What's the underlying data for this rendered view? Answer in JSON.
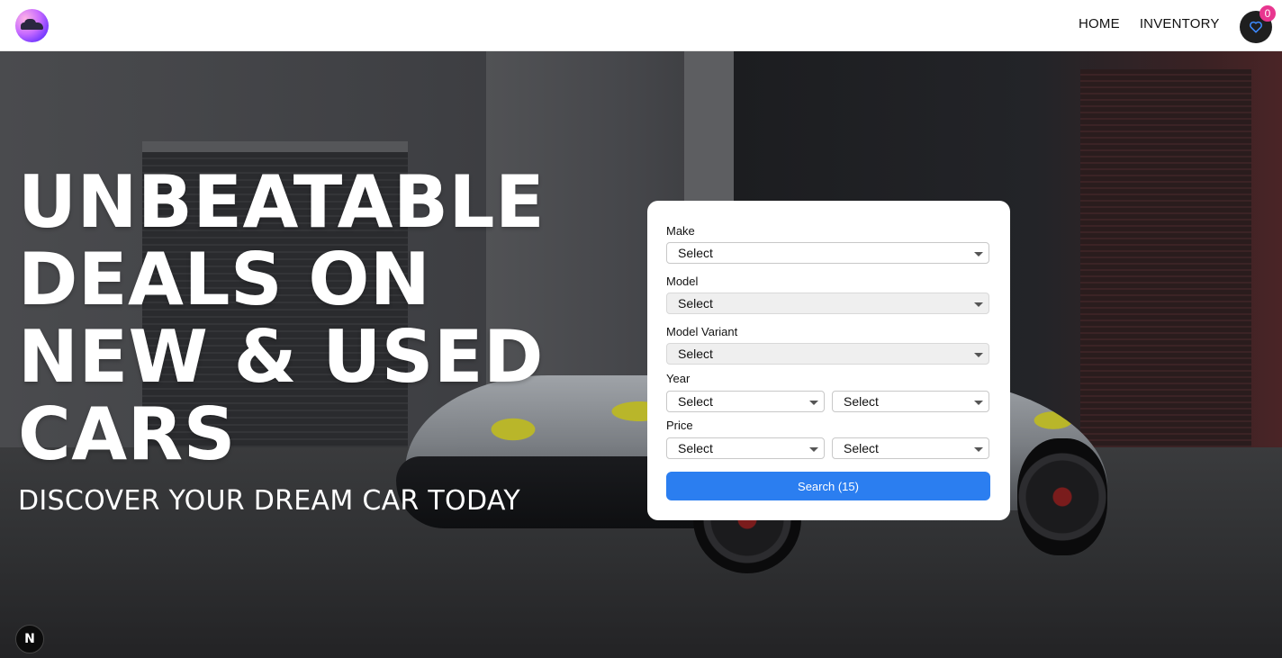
{
  "header": {
    "logo_icon": "car-logo-icon",
    "nav": [
      {
        "label": "HOME"
      },
      {
        "label": "INVENTORY"
      }
    ],
    "favorites": {
      "icon": "heart-icon",
      "count": "0",
      "accent": "#e8368f"
    }
  },
  "hero": {
    "headline_lines": [
      "UNBEATABLE",
      "DEALS ON",
      "NEW & USED",
      "CARS"
    ],
    "subheadline": "DISCOVER YOUR DREAM CAR TODAY"
  },
  "search": {
    "make": {
      "label": "Make",
      "value": "Select"
    },
    "model": {
      "label": "Model",
      "value": "Select"
    },
    "variant": {
      "label": "Model Variant",
      "value": "Select"
    },
    "year": {
      "label": "Year",
      "from": "Select",
      "to": "Select"
    },
    "price": {
      "label": "Price",
      "from": "Select",
      "to": "Select"
    },
    "button_label": "Search (15)",
    "button_color": "#2b7ef0"
  },
  "devtools": {
    "badge_label": "N"
  }
}
